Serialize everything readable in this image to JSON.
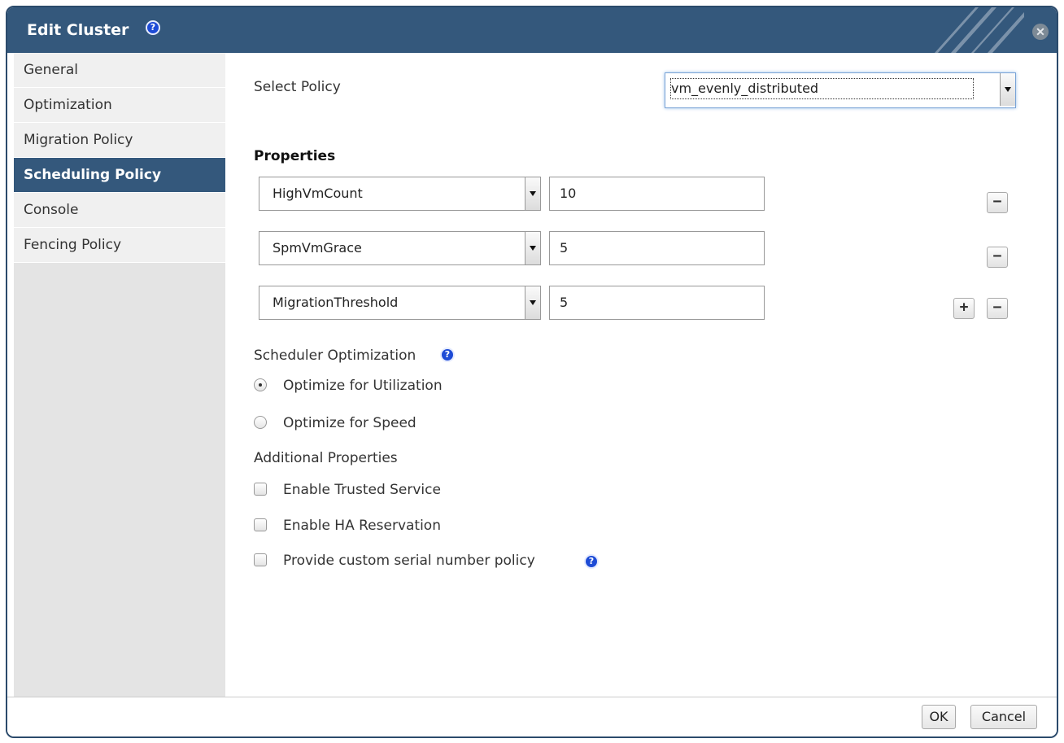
{
  "dialog": {
    "title": "Edit Cluster",
    "help_glyph": "?",
    "close_glyph": "✕"
  },
  "sidebar": {
    "items": [
      {
        "label": "General"
      },
      {
        "label": "Optimization"
      },
      {
        "label": "Migration Policy"
      },
      {
        "label": "Scheduling Policy",
        "active": true
      },
      {
        "label": "Console"
      },
      {
        "label": "Fencing Policy"
      }
    ]
  },
  "policy": {
    "label": "Select Policy",
    "value": "vm_evenly_distributed"
  },
  "properties": {
    "heading": "Properties",
    "rows": [
      {
        "key": "HighVmCount",
        "value": "10"
      },
      {
        "key": "SpmVmGrace",
        "value": "5"
      },
      {
        "key": "MigrationThreshold",
        "value": "5"
      }
    ],
    "add_glyph": "+",
    "remove_glyph": "−"
  },
  "scheduler_optimization": {
    "label": "Scheduler Optimization",
    "options": [
      {
        "label": "Optimize for Utilization",
        "selected": true
      },
      {
        "label": "Optimize for Speed",
        "selected": false
      }
    ]
  },
  "additional_properties": {
    "label": "Additional Properties",
    "checkboxes": [
      {
        "label": "Enable Trusted Service",
        "checked": false
      },
      {
        "label": "Enable HA Reservation",
        "checked": false
      },
      {
        "label": "Provide custom serial number policy",
        "checked": false
      }
    ]
  },
  "footer": {
    "ok_label": "OK",
    "cancel_label": "Cancel"
  },
  "colors": {
    "titlebar": "#34587c",
    "active_tab": "#34587c",
    "help_icon": "#1d4bd6"
  }
}
